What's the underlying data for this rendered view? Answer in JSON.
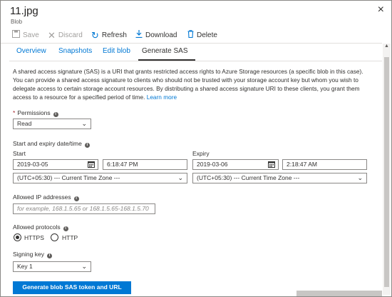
{
  "header": {
    "title": "11.jpg",
    "subtitle": "Blob",
    "close_glyph": "×"
  },
  "toolbar": {
    "save": {
      "label": "Save",
      "icon": "save-icon"
    },
    "discard": {
      "label": "Discard",
      "icon": "discard-icon"
    },
    "refresh": {
      "label": "Refresh",
      "icon": "refresh-icon"
    },
    "download": {
      "label": "Download",
      "icon": "download-icon"
    },
    "delete": {
      "label": "Delete",
      "icon": "delete-icon"
    }
  },
  "tabs": [
    {
      "label": "Overview",
      "active": false
    },
    {
      "label": "Snapshots",
      "active": false
    },
    {
      "label": "Edit blob",
      "active": false
    },
    {
      "label": "Generate SAS",
      "active": true
    }
  ],
  "description": {
    "text": "A shared access signature (SAS) is a URI that grants restricted access rights to Azure Storage resources (a specific blob in this case). You can provide a shared access signature to clients who should not be trusted with your storage account key but whom you wish to delegate access to certain storage account resources. By distributing a shared access signature URI to these clients, you grant them access to a resource for a specified period of time.",
    "link": "Learn more"
  },
  "permissions": {
    "label": "Permissions",
    "value": "Read"
  },
  "dates": {
    "section_label": "Start and expiry date/time",
    "start": {
      "label": "Start",
      "date": "2019-03-05",
      "time": "6:18:47 PM",
      "timezone": "(UTC+05:30) --- Current Time Zone ---"
    },
    "expiry": {
      "label": "Expiry",
      "date": "2019-03-06",
      "time": "2:18:47 AM",
      "timezone": "(UTC+05:30) --- Current Time Zone ---"
    }
  },
  "ip": {
    "label": "Allowed IP addresses",
    "placeholder": "for example, 168.1.5.65 or 168.1.5.65-168.1.5.70",
    "value": ""
  },
  "protocols": {
    "label": "Allowed protocols",
    "options": [
      "HTTPS",
      "HTTP"
    ],
    "selected": "HTTPS"
  },
  "signing_key": {
    "label": "Signing key",
    "value": "Key 1"
  },
  "generate_button": {
    "label": "Generate blob SAS token and URL"
  },
  "colors": {
    "accent": "#0078d4",
    "text": "#323130",
    "required": "#a4262c",
    "border": "#8a8886"
  }
}
